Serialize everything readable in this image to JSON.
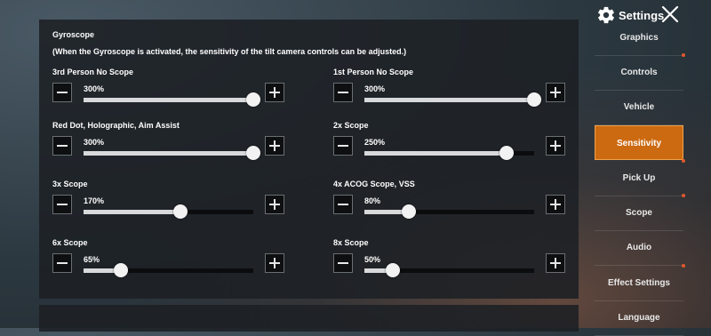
{
  "header": {
    "title": "Settings"
  },
  "gyroscope": {
    "title": "Gyroscope",
    "note": "(When the Gyroscope is activated, the sensitivity of the tilt camera controls can be adjusted.)",
    "sliders": [
      {
        "label": "3rd Person No Scope",
        "value_text": "300%",
        "fraction": 1.0
      },
      {
        "label": "1st Person No Scope",
        "value_text": "300%",
        "fraction": 1.0
      },
      {
        "label": "Red Dot, Holographic, Aim Assist",
        "value_text": "300%",
        "fraction": 1.0
      },
      {
        "label": "2x Scope",
        "value_text": "250%",
        "fraction": 0.84
      },
      {
        "label": "3x Scope",
        "value_text": "170%",
        "fraction": 0.57
      },
      {
        "label": "4x ACOG Scope, VSS",
        "value_text": "80%",
        "fraction": 0.26
      },
      {
        "label": "6x Scope",
        "value_text": "65%",
        "fraction": 0.22
      },
      {
        "label": "8x Scope",
        "value_text": "50%",
        "fraction": 0.17
      }
    ]
  },
  "sidebar": {
    "items": [
      {
        "label": "Graphics",
        "dot": false
      },
      {
        "label": "Controls",
        "dot": true
      },
      {
        "label": "Vehicle",
        "dot": false
      },
      {
        "label": "Sensitivity",
        "dot": false,
        "active": true
      },
      {
        "label": "Pick Up",
        "dot": true
      },
      {
        "label": "Scope",
        "dot": true
      },
      {
        "label": "Audio",
        "dot": false
      },
      {
        "label": "Effect Settings",
        "dot": true
      },
      {
        "label": "Language",
        "dot": false
      }
    ]
  }
}
